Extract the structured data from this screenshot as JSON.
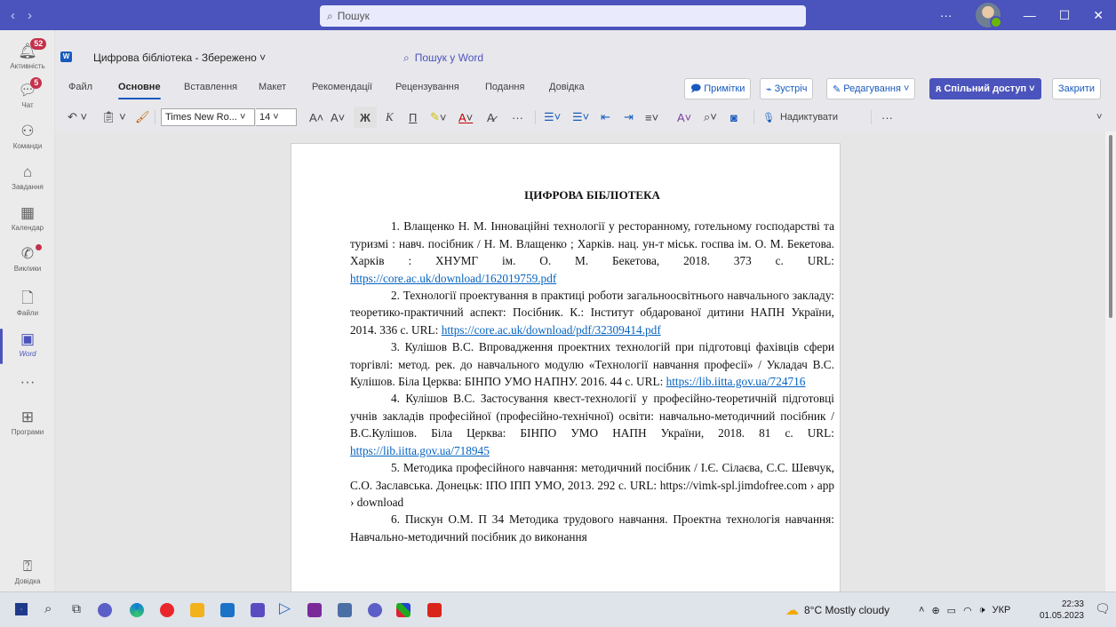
{
  "titlebar": {
    "search_placeholder": "Пошук",
    "more": "···"
  },
  "rail": [
    {
      "label": "Активність",
      "icon": "bell-icon",
      "badge": "52"
    },
    {
      "label": "Чат",
      "icon": "chat-icon",
      "badge": "5"
    },
    {
      "label": "Команди",
      "icon": "teams-icon"
    },
    {
      "label": "Завдання",
      "icon": "tasks-icon"
    },
    {
      "label": "Календар",
      "icon": "calendar-icon"
    },
    {
      "label": "Виклики",
      "icon": "calls-icon",
      "dot": true
    },
    {
      "label": "Файли",
      "icon": "file-icon"
    },
    {
      "label": "Word",
      "icon": "word-icon",
      "active": true
    },
    {
      "label": "",
      "icon": "more-icon"
    },
    {
      "label": "Програми",
      "icon": "apps-icon"
    },
    {
      "label": "Довідка",
      "icon": "help-icon"
    }
  ],
  "doc": {
    "title": "Цифрова бібліотека - Збережено",
    "word_search": "Пошук у Word"
  },
  "tabs": [
    "Файл",
    "Основне",
    "Вставлення",
    "Макет",
    "Рекомендації",
    "Рецензування",
    "Подання",
    "Довідка"
  ],
  "ribbon_buttons": {
    "comments": "Примітки",
    "meet": "Зустріч",
    "editing": "Редагування",
    "share": "Спільний доступ",
    "close": "Закрити"
  },
  "toolbar": {
    "font": "Times New Ro...",
    "size": "14",
    "dictate": "Надиктувати",
    "more": "···"
  },
  "document": {
    "heading": "ЦИФРОВА БІБЛІОТЕКА",
    "items": [
      {
        "text": "1. Влащенко Н. М. Інноваційні технології у ресторанному, готельному господарстві та туризмі : навч. посібник / Н. М. Влащенко ; Харків. нац. ун-т міськ. госпва ім. О. М. Бекетова. Харків : ХНУМГ ім. О. М. Бекетова, 2018. 373 с. URL: ",
        "url": "https://core.ac.uk/download/162019759.pdf"
      },
      {
        "text": "2. Технології проектування в практиці роботи загальноосвітнього навчального закладу: теоретико-практичний аспект: Посібник. К.: Інститут обдарованої дитини НАПН України, 2014. 336 с. URL: ",
        "url": "https://core.ac.uk/download/pdf/32309414.pdf"
      },
      {
        "text": "3. Кулішов В.С. Впровадження проектних технологій при підготовці фахівців сфери торгівлі: метод. рек. до навчального модулю «Технології навчання професії» / Укладач В.С. Кулішов. Біла Церква: БІНПО УМО НАПНУ. 2016. 44 с. URL: ",
        "url": "https://lib.iitta.gov.ua/724716"
      },
      {
        "text": "4. Кулішов В.С. Застосування квест-технології у професійно-теоретичній підготовці учнів закладів професійної (професійно-технічної) освіти: навчально-методичний посібник / В.С.Кулішов. Біла Церква: БІНПО УМО НАПН України, 2018. 81 с. URL: ",
        "url": "https://lib.iitta.gov.ua/718945"
      },
      {
        "text": "5. Методика професійного навчання: методичний посібник / І.Є. Сілаєва, С.С. Шевчук, С.О. Заславська. Донецьк: ІПО ІПП УМО, 2013. 292 с. URL: https://vimk-spl.jimdofree.com › app › download",
        "url": ""
      },
      {
        "text": "6. Пискун О.М. П 34 Методика трудового навчання. Проектна технологія навчання: Навчально-методичний посібник до виконання",
        "url": ""
      }
    ]
  },
  "tray": {
    "weather": "8°C Mostly cloudy",
    "lang": "УКР",
    "time": "22:33",
    "date": "01.05.2023"
  }
}
